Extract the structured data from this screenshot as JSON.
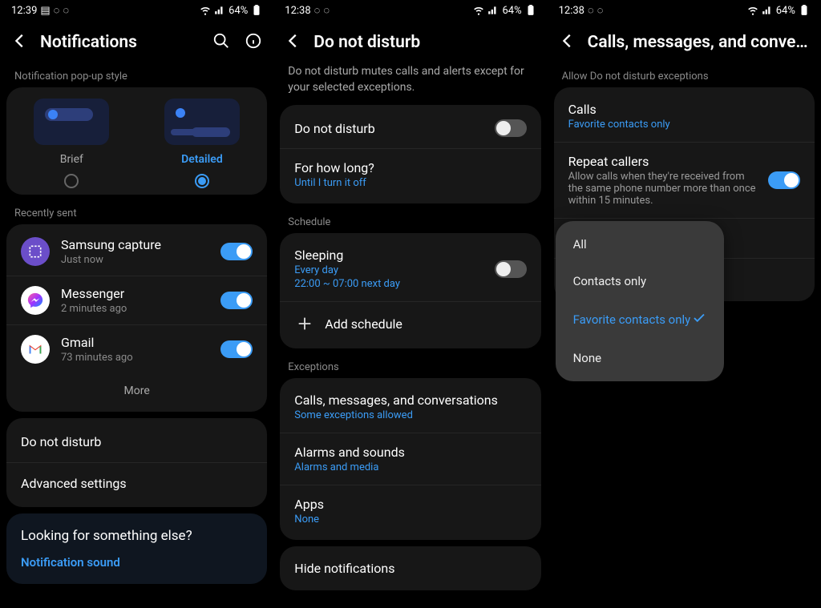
{
  "status": {
    "time1": "12:39",
    "time2": "12:38",
    "time3": "12:38",
    "battery": "64%"
  },
  "screen1": {
    "title": "Notifications",
    "popup_section": "Notification pop-up style",
    "brief": "Brief",
    "detailed": "Detailed",
    "recent_label": "Recently sent",
    "apps": [
      {
        "name": "Samsung capture",
        "sub": "Just now"
      },
      {
        "name": "Messenger",
        "sub": "2 minutes ago"
      },
      {
        "name": "Gmail",
        "sub": "73 minutes ago"
      }
    ],
    "more": "More",
    "dnd": "Do not disturb",
    "advanced": "Advanced settings",
    "else_title": "Looking for something else?",
    "else_link": "Notification sound"
  },
  "screen2": {
    "title": "Do not disturb",
    "desc": "Do not disturb mutes calls and alerts except for your selected exceptions.",
    "dnd_row": "Do not disturb",
    "how_long": "For how long?",
    "how_long_sub": "Until I turn it off",
    "schedule_label": "Schedule",
    "sleeping": "Sleeping",
    "sleeping_sub1": "Every day",
    "sleeping_sub2": "22:00 ~ 07:00 next day",
    "add_schedule": "Add schedule",
    "exceptions_label": "Exceptions",
    "ex1": "Calls, messages, and conversations",
    "ex1_sub": "Some exceptions allowed",
    "ex2": "Alarms and sounds",
    "ex2_sub": "Alarms and media",
    "ex3": "Apps",
    "ex3_sub": "None",
    "hide": "Hide notifications"
  },
  "screen3": {
    "title": "Calls, messages, and conversa…",
    "allow_label": "Allow Do not disturb exceptions",
    "calls": "Calls",
    "calls_sub": "Favorite contacts only",
    "repeat": "Repeat callers",
    "repeat_sub": "Allow calls when they're received from the same phone number more than once within 15 minutes.",
    "options": [
      "All",
      "Contacts only",
      "Favorite contacts only",
      "None"
    ]
  }
}
